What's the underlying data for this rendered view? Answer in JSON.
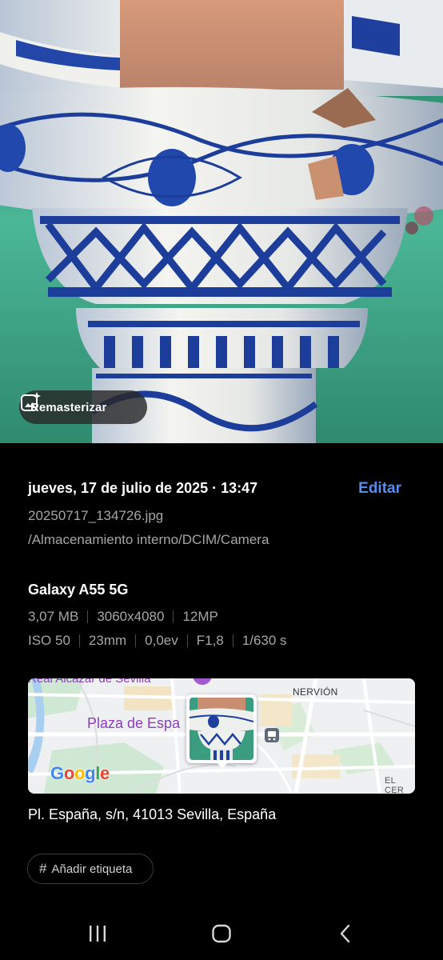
{
  "photo": {
    "remaster_label": "Remasterizar",
    "remaster_icon": "sparkle-image-icon"
  },
  "details": {
    "datetime": "jueves, 17 de julio de 2025 · 13:47",
    "edit_label": "Editar",
    "filename": "20250717_134726.jpg",
    "path": "/Almacenamiento interno/DCIM/Camera",
    "device": "Galaxy A55 5G",
    "specs_row1": [
      "3,07 MB",
      "3060x4080",
      "12MP"
    ],
    "specs_row2": [
      "ISO 50",
      "23mm",
      "0,0ev",
      "F1,8",
      "1/630 s"
    ]
  },
  "map": {
    "place_label": "Plaza de Espa",
    "top_label": "Real Alcázar de Sevilla",
    "district_label": "NERVIÓN",
    "corner_label": "EL CER",
    "logo_text": "Google"
  },
  "address": "Pl. España, s/n, 41013 Sevilla, España",
  "tag_chip_label": "Añadir etiqueta",
  "navbar": {
    "recents_icon": "recents-icon",
    "home_icon": "home-icon",
    "back_icon": "back-icon"
  },
  "colors": {
    "accent": "#5a8cf0",
    "background": "#000000",
    "secondary_text": "#a6a6a6",
    "map_label_purple": "#8a3fb5"
  }
}
